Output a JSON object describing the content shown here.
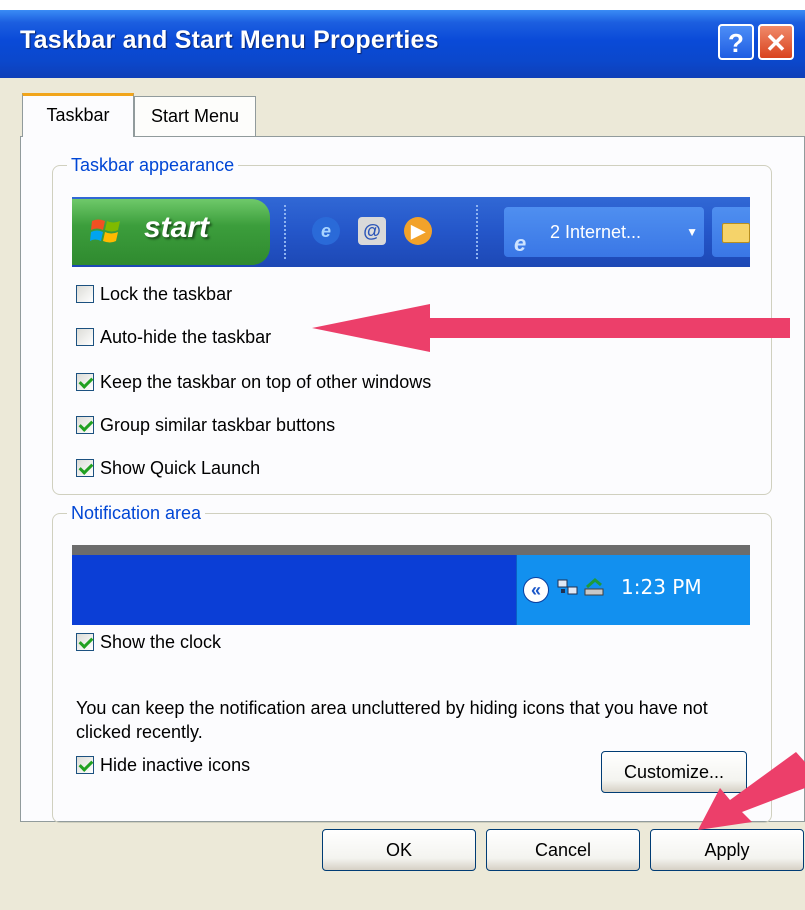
{
  "window": {
    "title": "Taskbar and Start Menu Properties",
    "help_label": "?",
    "close_label": "✕"
  },
  "tabs": [
    {
      "label": "Taskbar",
      "active": true
    },
    {
      "label": "Start Menu",
      "active": false
    }
  ],
  "taskbar_appearance": {
    "legend": "Taskbar appearance",
    "preview": {
      "start_label": "start",
      "task_button_label": "2 Internet...",
      "quick_launch_icons": [
        "ie-icon",
        "outlook-icon",
        "media-player-icon"
      ]
    },
    "options": [
      {
        "label": "Lock the taskbar",
        "checked": false
      },
      {
        "label": "Auto-hide the taskbar",
        "checked": false
      },
      {
        "label": "Keep the taskbar on top of other windows",
        "checked": true
      },
      {
        "label": "Group similar taskbar buttons",
        "checked": true
      },
      {
        "label": "Show Quick Launch",
        "checked": true
      }
    ]
  },
  "notification_area": {
    "legend": "Notification area",
    "preview": {
      "clock": "1:23 PM",
      "chevron": "«"
    },
    "show_clock": {
      "label": "Show the clock",
      "checked": true
    },
    "description": "You can keep the notification area uncluttered by hiding icons that you have not clicked recently.",
    "hide_inactive": {
      "label": "Hide inactive icons",
      "checked": true
    },
    "customize_label": "Customize..."
  },
  "buttons": {
    "ok": "OK",
    "cancel": "Cancel",
    "apply": "Apply"
  },
  "colors": {
    "titlebar": "#0b48cc",
    "legend": "#0046d5",
    "annotation_arrow": "#ec3f6a",
    "dialog_bg": "#ece9d8"
  }
}
